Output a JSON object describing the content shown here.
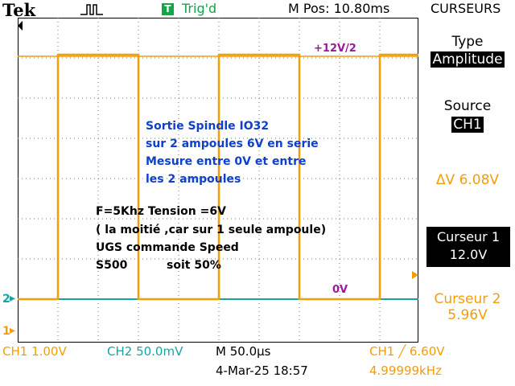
{
  "header": {
    "brand": "Tek",
    "trigger_box": "T",
    "trigger_state": "Trig'd",
    "m_pos": "M Pos: 10.80ms",
    "menu_title": "CURSEURS"
  },
  "side_menu": {
    "type_label": "Type",
    "type_value": "Amplitude",
    "source_label": "Source",
    "source_value": "CH1",
    "delta_v": "ΔV 6.08V",
    "cursor1_label": "Curseur 1",
    "cursor1_value": "12.0V",
    "cursor2_label": "Curseur 2",
    "cursor2_value": "5.96V"
  },
  "annotations": {
    "cursor_top_label": "+12V/2",
    "cursor_bottom_label": "0V",
    "note_lines": [
      "Sortie Spindle IO32",
      "sur 2 ampoules 6V en serie",
      "Mesure entre 0V et entre",
      "les 2 ampoules"
    ],
    "info_lines": [
      "F=5Khz  Tension =6V",
      "( la moitié ,car sur 1 seule ampoule)",
      "UGS  commande Speed",
      "S500          soit 50%"
    ]
  },
  "markers": {
    "ch2": "2",
    "ch1": "1"
  },
  "bottom_bar": {
    "ch1_scale": "CH1  1.00V",
    "ch2_scale": "CH2  50.0mV",
    "time_scale": "M 50.0µs",
    "trigger": "CH1 ╱ 6.60V",
    "date": "4-Mar-25 18:57",
    "frequency": "4.99999kHz"
  },
  "colors": {
    "ch1": "#f29d0a",
    "ch2": "#18a3a3",
    "cursor_label": "#9a1b9a",
    "note": "#1040c8",
    "trigger_box": "#16a34a"
  },
  "waveform": {
    "ch1_duty_cycle": 0.5
  }
}
